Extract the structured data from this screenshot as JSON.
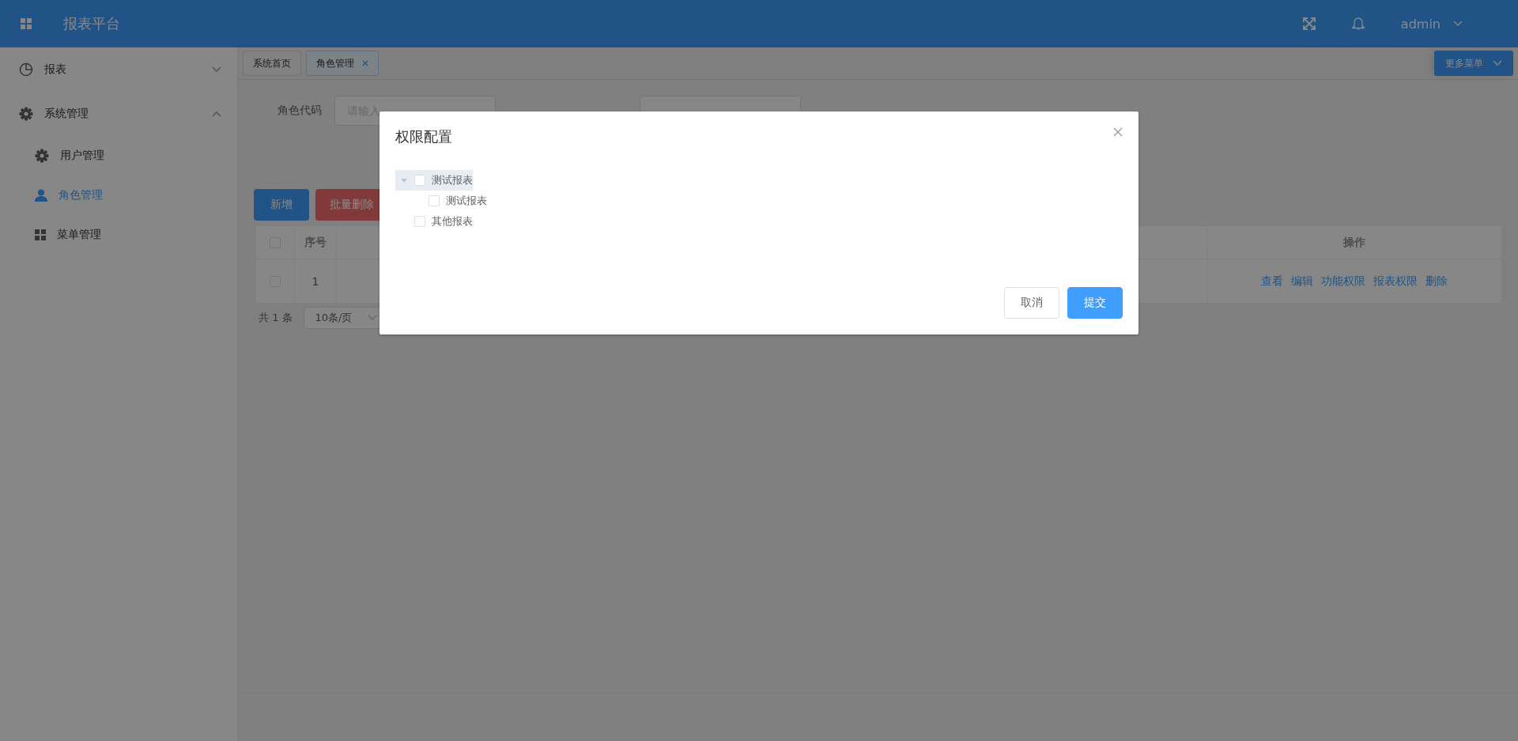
{
  "header": {
    "title": "报表平台",
    "user": "admin"
  },
  "sidebar": {
    "items": [
      {
        "label": "报表",
        "expanded": false
      },
      {
        "label": "系统管理",
        "expanded": true,
        "children": [
          {
            "label": "用户管理",
            "selected": false
          },
          {
            "label": "角色管理",
            "selected": true
          },
          {
            "label": "菜单管理",
            "selected": false
          }
        ]
      }
    ]
  },
  "tabs": [
    {
      "label": "系统首页",
      "selected": false,
      "closable": false
    },
    {
      "label": "角色管理",
      "selected": true,
      "closable": true
    }
  ],
  "more_menu": "更多菜单",
  "search": [
    {
      "kind": "field",
      "label": "角色代码",
      "placeholder": "请输入"
    },
    {
      "kind": "field"
    }
  ],
  "actions": [
    {
      "label": "新增",
      "kind": "primary"
    },
    {
      "label": "批量删除",
      "kind": "danger"
    }
  ],
  "table": {
    "columns": [
      {
        "kind": "check",
        "checked": false
      },
      {
        "kind": "text",
        "label": "序号"
      },
      {
        "kind": "blank"
      },
      {
        "kind": "text",
        "label": "操作"
      }
    ],
    "rows": [
      {
        "checked": false,
        "index": "1",
        "links": [
          "查看",
          "编辑",
          "功能权限",
          "报表权限",
          "删除"
        ]
      }
    ]
  },
  "pagination": {
    "total": "共 1 条",
    "page_size": "10条/页"
  },
  "dialog": {
    "title": "权限配置",
    "tree": [
      {
        "label": "测试报表",
        "checked": false,
        "selected": true,
        "expanded": true,
        "children": [
          {
            "label": "测试报表",
            "checked": false,
            "selected": false
          }
        ]
      },
      {
        "label": "其他报表",
        "checked": false,
        "selected": false
      }
    ],
    "buttons": [
      {
        "label": "取消",
        "kind": "default"
      },
      {
        "label": "提交",
        "kind": "primary"
      }
    ]
  }
}
